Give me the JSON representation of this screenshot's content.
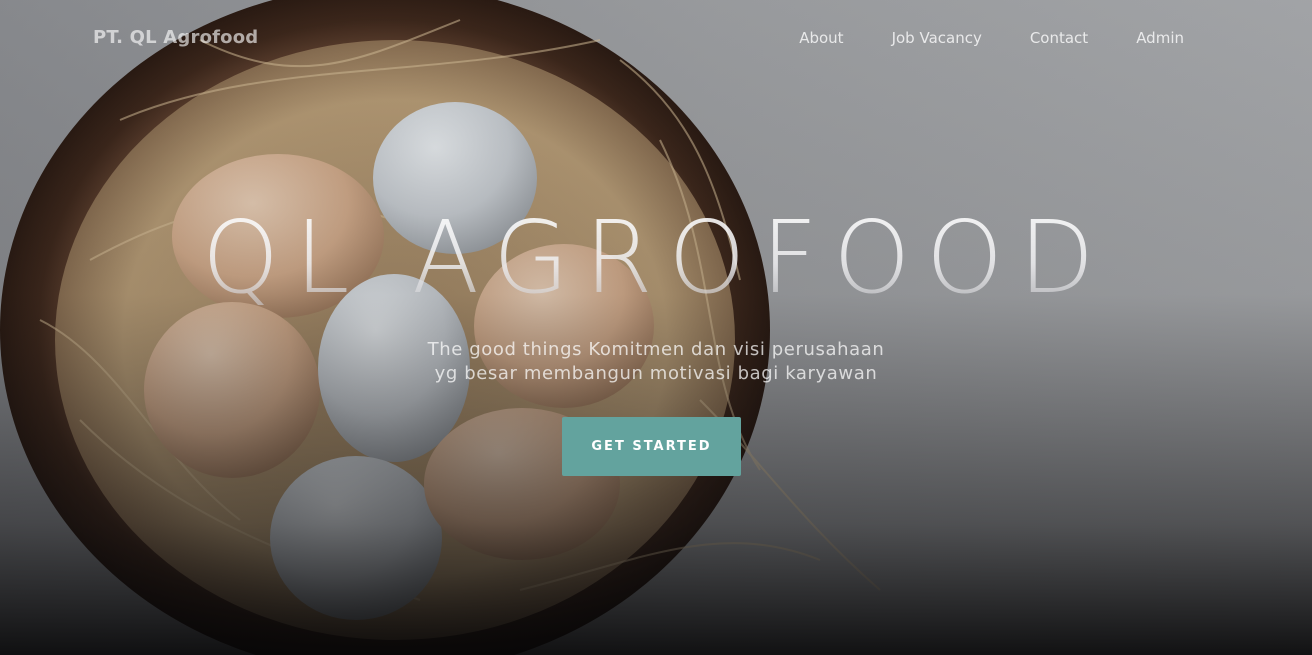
{
  "brand": "PT. QL Agrofood",
  "nav": {
    "items": [
      {
        "label": "About"
      },
      {
        "label": "Job Vacancy"
      },
      {
        "label": "Contact"
      },
      {
        "label": "Admin"
      }
    ]
  },
  "hero": {
    "title": "QL AGROFOOD",
    "subtitle_line1": "The good things Komitmen dan visi perusahaan",
    "subtitle_line2": "yg besar membangun motivasi bagi karyawan",
    "cta_label": "GET STARTED",
    "background": "basket-of-eggs-photo"
  },
  "colors": {
    "accent": "#63a39e",
    "background_top": "#9a9b9d",
    "background_bottom": "#050506"
  }
}
